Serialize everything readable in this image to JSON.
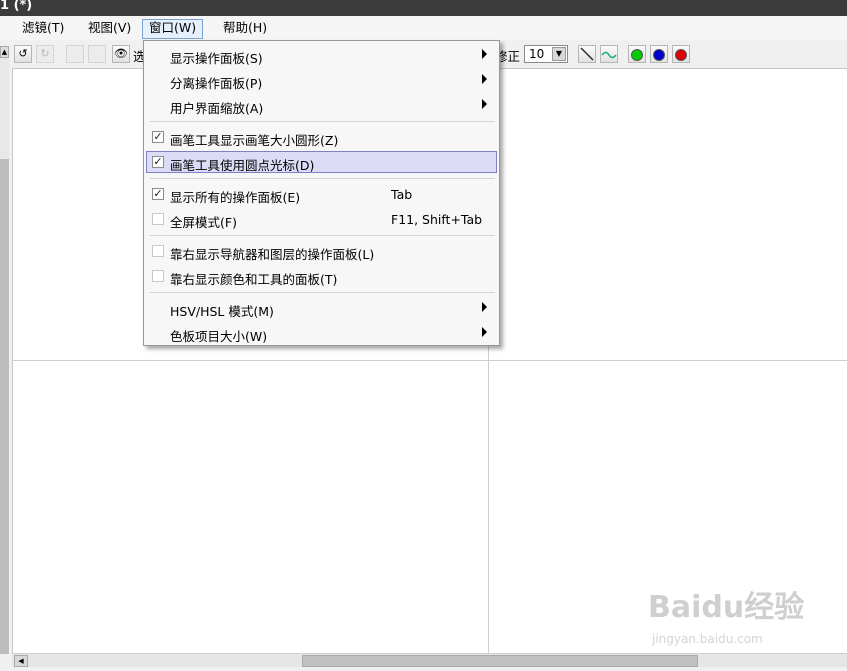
{
  "window": {
    "title": "1 (*)"
  },
  "menubar": {
    "items": [
      {
        "label": "滤镜(T)"
      },
      {
        "label": "视图(V)"
      },
      {
        "label": "窗口(W)"
      },
      {
        "label": "帮助(H)"
      }
    ]
  },
  "toolbar": {
    "eye_label": "选",
    "correction_label": "修正",
    "correction_value": "10",
    "colors": [
      "#00cc00",
      "#0000cc",
      "#dd0000"
    ]
  },
  "window_menu": {
    "items": [
      {
        "label": "显示操作面板(S)",
        "submenu": true
      },
      {
        "label": "分离操作面板(P)",
        "submenu": true
      },
      {
        "label": "用户界面缩放(A)",
        "submenu": true
      },
      {
        "label": "画笔工具显示画笔大小圆形(Z)",
        "checked": true
      },
      {
        "label": "画笔工具使用圆点光标(D)",
        "checked": true,
        "highlighted": true
      },
      {
        "label": "显示所有的操作面板(E)",
        "checked": true,
        "shortcut": "Tab"
      },
      {
        "label": "全屏模式(F)",
        "checked": false,
        "shortcut": "F11, Shift+Tab"
      },
      {
        "label": "靠右显示导航器和图层的操作面板(L)",
        "checked": false
      },
      {
        "label": "靠右显示颜色和工具的面板(T)",
        "checked": false
      },
      {
        "label": "HSV/HSL 模式(M)",
        "submenu": true
      },
      {
        "label": "色板项目大小(W)",
        "submenu": true
      }
    ]
  },
  "watermark": {
    "text": "Baidu经验",
    "url": "jingyan.baidu.com"
  }
}
